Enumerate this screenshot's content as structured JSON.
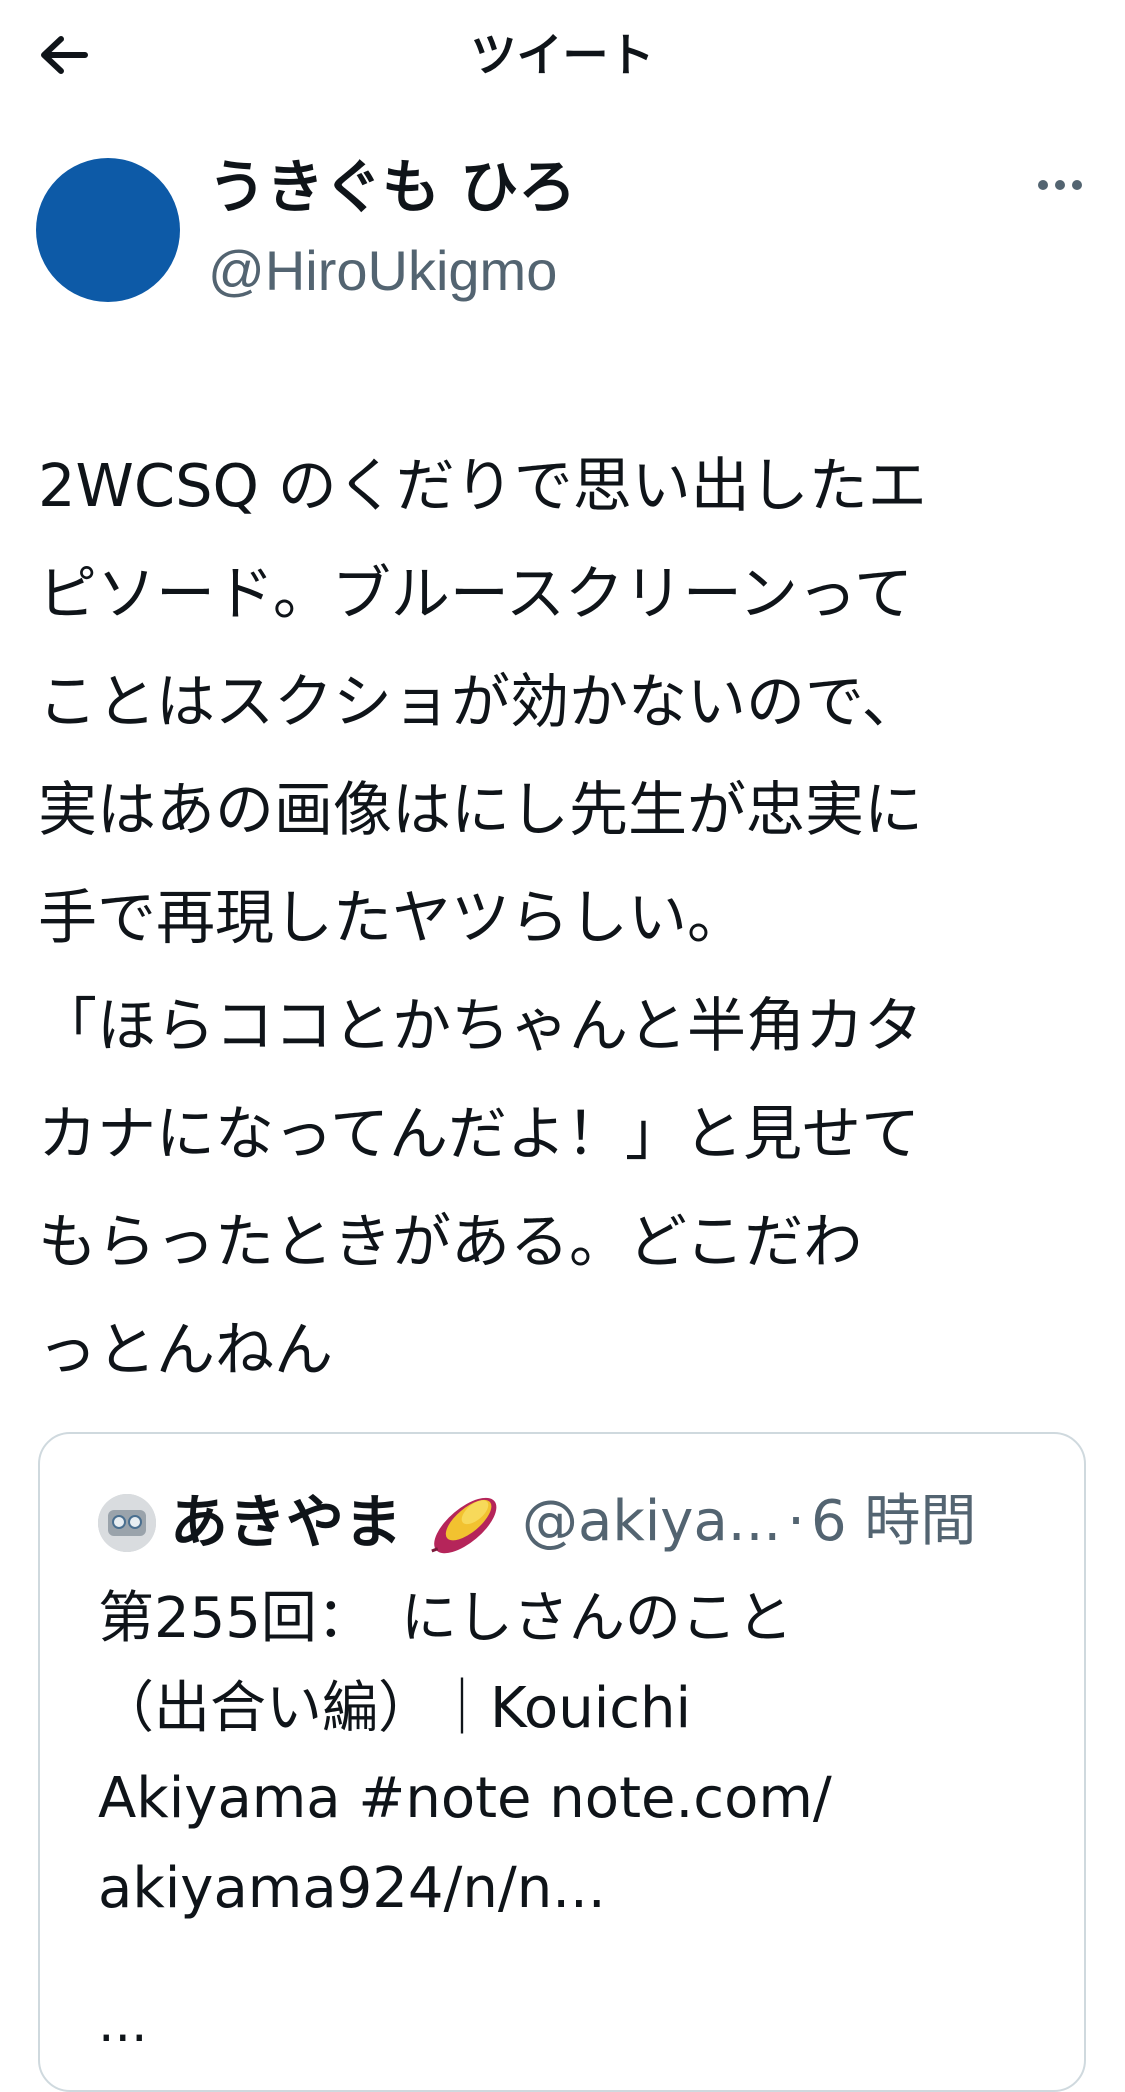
{
  "header": {
    "title": "ツイート",
    "back_icon": "arrow-left-icon"
  },
  "author": {
    "display_name": "うきぐも ひろ",
    "handle": "@HiroUkigmo",
    "avatar_color": "#0d5aa7"
  },
  "menu": {
    "icon": "more-horizontal-icon"
  },
  "tweet": {
    "lines": [
      "2WCSQ のくだりで思い出したエ",
      "ピソード。ブルースクリーンって",
      "ことはスクショが効かないので、",
      "実はあの画像はにし先生が忠実に",
      "手で再現したヤツらしい。",
      "「ほらココとかちゃんと半角カタ",
      "カナになってんだよ！」と見せて",
      "もらったときがある。どこだわ",
      "っとんねん"
    ]
  },
  "quote": {
    "display_name": "あきやま",
    "emoji": "sweet-potato-icon",
    "handle": "@akiya...",
    "separator": "·",
    "time": "6 時間",
    "lines": [
      "第255回：　にしさんのこと",
      "（出合い編）｜Kouichi",
      "Akiyama #note note.com/",
      "akiyama924/n/n..."
    ],
    "ellipsis": "..."
  },
  "colors": {
    "text": "#0f1419",
    "secondary": "#536471",
    "border": "#cfd9de"
  }
}
